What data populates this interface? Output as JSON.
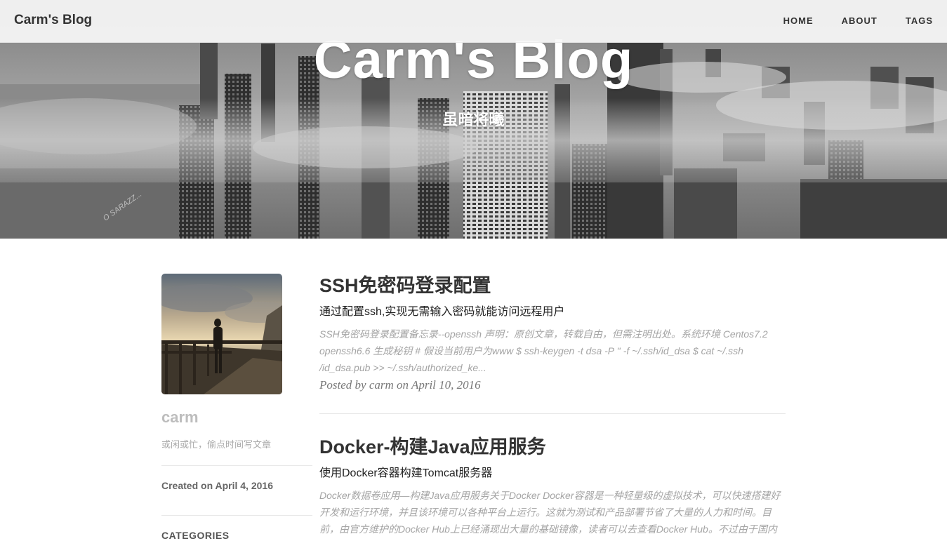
{
  "navbar": {
    "brand": "Carm's Blog",
    "links": [
      {
        "label": "HOME"
      },
      {
        "label": "ABOUT"
      },
      {
        "label": "TAGS"
      }
    ]
  },
  "hero": {
    "title": "Carm's Blog",
    "subtitle": "虽暗将曦",
    "watermark": "O SARAZZ..."
  },
  "sidebar": {
    "author_name": "carm",
    "bio": "或闲或忙，偷点时间写文章",
    "created": "Created on April 4, 2016",
    "categories_label": "CATEGORIES"
  },
  "posts": [
    {
      "title": "SSH免密码登录配置",
      "subtitle": "通过配置ssh,实现无需输入密码就能访问远程用户",
      "excerpt": "SSH免密码登录配置备忘录--openssh 声明：原创文章，转载自由，但需注明出处。系统环境 Centos7.2 openssh6.6 生成秘钥 # 假设当前用户为www $ ssh-keygen -t dsa -P '' -f ~/.ssh/id_dsa $ cat ~/.ssh /id_dsa.pub >> ~/.ssh/authorized_ke...",
      "meta": "Posted by carm on April 10, 2016"
    },
    {
      "title": "Docker-构建Java应用服务",
      "subtitle": "使用Docker容器构建Tomcat服务器",
      "excerpt": "Docker数据卷应用—构建Java应用服务关于Docker Docker容器是一种轻量级的虚拟技术，可以快速搭建好开发和运行环境，并且该环境可以各种平台上运行。这就为测试和产品部署节省了大量的人力和时间。目前，由官方维护的Docker Hub上已经涌现出大量的基础镜像，读者可以去查看Docker Hub。不过由于国内"
    }
  ]
}
